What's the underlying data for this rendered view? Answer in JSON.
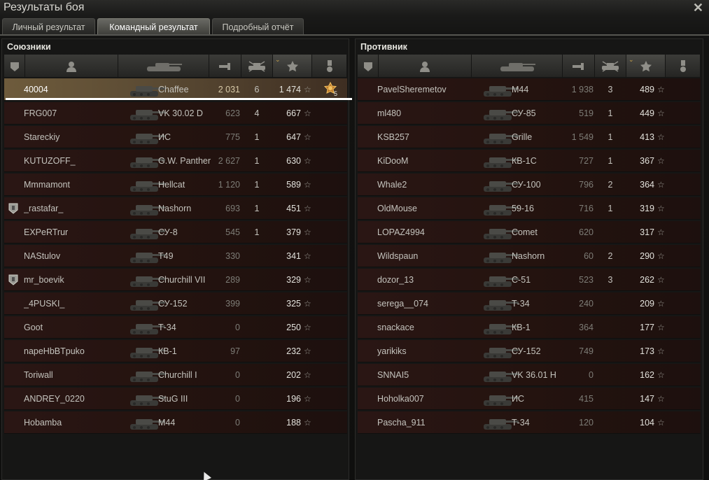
{
  "window": {
    "title": "Результаты боя",
    "close_icon": "close-icon"
  },
  "tabs": [
    {
      "label": "Личный результат",
      "active": false
    },
    {
      "label": "Командный результат",
      "active": true
    },
    {
      "label": "Подробный отчёт",
      "active": false
    }
  ],
  "allies": {
    "title": "Союзники",
    "header_icons": [
      "platoon-icon",
      "player-icon",
      "tank-icon",
      "damage-icon",
      "frags-icon",
      "xp-icon",
      "medal-icon"
    ],
    "rows": [
      {
        "name": "40004",
        "tank": "Chaffee",
        "damage": "2 031",
        "frags": "6",
        "xp": "1 474",
        "self": true,
        "medal": "5",
        "badge": false
      },
      {
        "name": "FRG007",
        "tank": "VK 30.02 D",
        "damage": "623",
        "frags": "4",
        "xp": "667",
        "self": false,
        "medal": "",
        "badge": false
      },
      {
        "name": "Stareckiy",
        "tank": "ИС",
        "damage": "775",
        "frags": "1",
        "xp": "647",
        "self": false,
        "medal": "",
        "badge": false
      },
      {
        "name": "KUTUZOFF_",
        "tank": "G.W. Panther",
        "damage": "2 627",
        "frags": "1",
        "xp": "630",
        "self": false,
        "medal": "",
        "badge": false
      },
      {
        "name": "Mmmamont",
        "tank": "Hellcat",
        "damage": "1 120",
        "frags": "1",
        "xp": "589",
        "self": false,
        "medal": "",
        "badge": false
      },
      {
        "name": "_rastafar_",
        "tank": "Nashorn",
        "damage": "693",
        "frags": "1",
        "xp": "451",
        "self": false,
        "medal": "",
        "badge": true
      },
      {
        "name": "EXPeRTrur",
        "tank": "СУ-8",
        "damage": "545",
        "frags": "1",
        "xp": "379",
        "self": false,
        "medal": "",
        "badge": false
      },
      {
        "name": "NAStulov",
        "tank": "T49",
        "damage": "330",
        "frags": "",
        "xp": "341",
        "self": false,
        "medal": "",
        "badge": false
      },
      {
        "name": "mr_boevik",
        "tank": "Churchill VII",
        "damage": "289",
        "frags": "",
        "xp": "329",
        "self": false,
        "medal": "",
        "badge": true
      },
      {
        "name": "_4PUSKI_",
        "tank": "СУ-152",
        "damage": "399",
        "frags": "",
        "xp": "325",
        "self": false,
        "medal": "",
        "badge": false
      },
      {
        "name": "Goot",
        "tank": "Т-34",
        "damage": "0",
        "frags": "",
        "xp": "250",
        "self": false,
        "medal": "",
        "badge": false
      },
      {
        "name": "napeHbBTpuko",
        "tank": "КВ-1",
        "damage": "97",
        "frags": "",
        "xp": "232",
        "self": false,
        "medal": "",
        "badge": false
      },
      {
        "name": "Toriwall",
        "tank": "Churchill I",
        "damage": "0",
        "frags": "",
        "xp": "202",
        "self": false,
        "medal": "",
        "badge": false
      },
      {
        "name": "ANDREY_0220",
        "tank": "StuG III",
        "damage": "0",
        "frags": "",
        "xp": "196",
        "self": false,
        "medal": "",
        "badge": false
      },
      {
        "name": "Hobamba",
        "tank": "M44",
        "damage": "0",
        "frags": "",
        "xp": "188",
        "self": false,
        "medal": "",
        "badge": false
      }
    ]
  },
  "enemies": {
    "title": "Противник",
    "header_icons": [
      "platoon-icon",
      "player-icon",
      "tank-icon",
      "damage-icon",
      "frags-icon",
      "xp-icon",
      "medal-icon"
    ],
    "rows": [
      {
        "name": "PavelSheremetov",
        "tank": "M44",
        "damage": "1 938",
        "frags": "3",
        "xp": "489"
      },
      {
        "name": "ml480",
        "tank": "СУ-85",
        "damage": "519",
        "frags": "1",
        "xp": "449"
      },
      {
        "name": "KSB257",
        "tank": "Grille",
        "damage": "1 549",
        "frags": "1",
        "xp": "413"
      },
      {
        "name": "KiDooM",
        "tank": "КВ-1С",
        "damage": "727",
        "frags": "1",
        "xp": "367"
      },
      {
        "name": "Whale2",
        "tank": "СУ-100",
        "damage": "796",
        "frags": "2",
        "xp": "364"
      },
      {
        "name": "OldMouse",
        "tank": "59-16",
        "damage": "716",
        "frags": "1",
        "xp": "319"
      },
      {
        "name": "LOPAZ4994",
        "tank": "Comet",
        "damage": "620",
        "frags": "",
        "xp": "317"
      },
      {
        "name": "Wildspaun",
        "tank": "Nashorn",
        "damage": "60",
        "frags": "2",
        "xp": "290"
      },
      {
        "name": "dozor_13",
        "tank": "С-51",
        "damage": "523",
        "frags": "3",
        "xp": "262"
      },
      {
        "name": "serega__074",
        "tank": "Т-34",
        "damage": "240",
        "frags": "",
        "xp": "209"
      },
      {
        "name": "snackace",
        "tank": "КВ-1",
        "damage": "364",
        "frags": "",
        "xp": "177"
      },
      {
        "name": "yarikiks",
        "tank": "СУ-152",
        "damage": "749",
        "frags": "",
        "xp": "173"
      },
      {
        "name": "SNNAI5",
        "tank": "VK 36.01 H",
        "damage": "0",
        "frags": "",
        "xp": "162"
      },
      {
        "name": "Hoholka007",
        "tank": "ИС",
        "damage": "415",
        "frags": "",
        "xp": "147"
      },
      {
        "name": "Pascha_911",
        "tank": "Т-34",
        "damage": "120",
        "frags": "",
        "xp": "104"
      }
    ]
  },
  "colors": {
    "self_row": "#6e5b3c",
    "row": "#24130f",
    "accent": "#c8a24a"
  }
}
